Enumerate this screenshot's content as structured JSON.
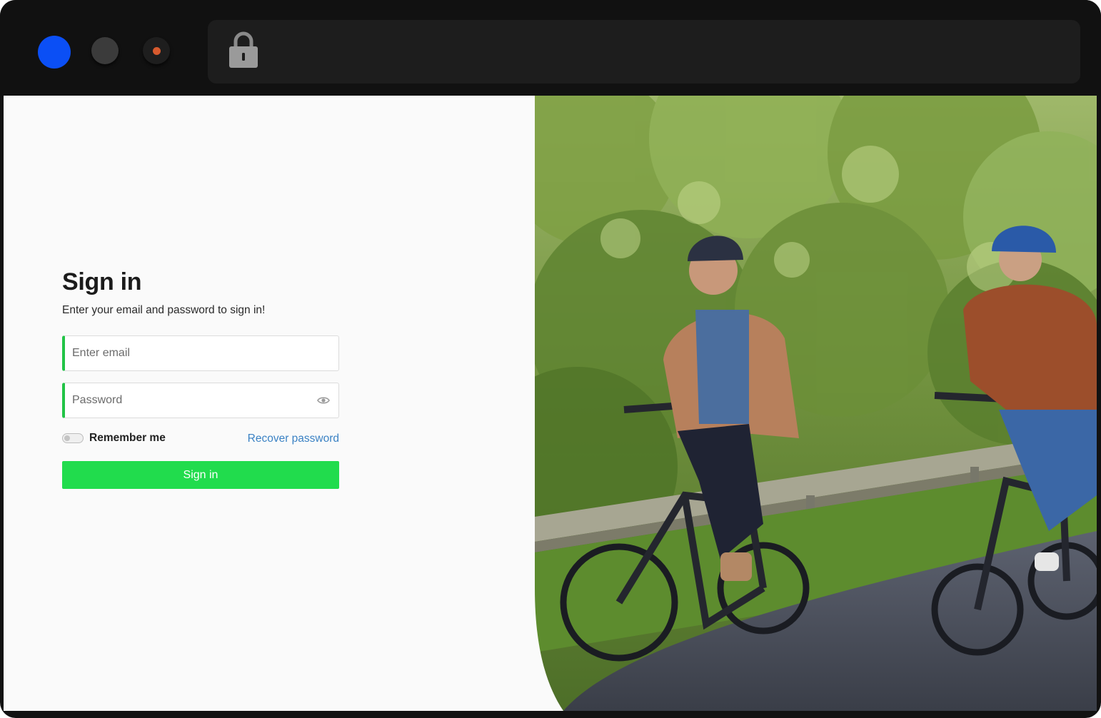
{
  "browser": {
    "controls": [
      "blue-dot",
      "grey-dot",
      "dark-dot"
    ],
    "address_icon": "lock-icon"
  },
  "signin": {
    "title": "Sign in",
    "subtitle": "Enter your email and password to sign in!",
    "email_placeholder": "Enter email",
    "password_placeholder": "Password",
    "remember_label": "Remember me",
    "recover_label": "Recover password",
    "submit_label": "Sign in"
  },
  "colors": {
    "accent_green": "#21dc4d",
    "field_border_green": "#22c447",
    "link_blue": "#3b82c4",
    "traffic_blue": "#0b4ff5"
  },
  "hero_image": {
    "description_icon": "cyclists-photo"
  }
}
